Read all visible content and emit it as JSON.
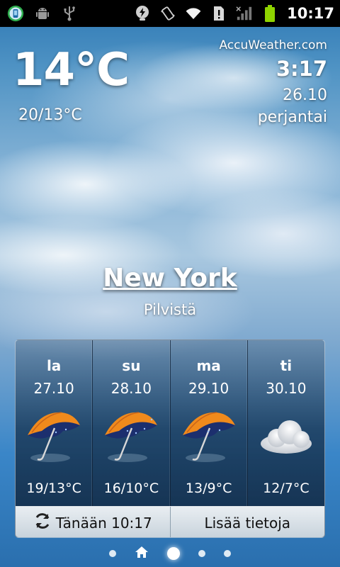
{
  "status_bar": {
    "clock": "10:17",
    "left_icons": [
      "app-notification-icon",
      "android-debug-icon",
      "usb-icon"
    ],
    "right_icons": [
      "lightbulb-icon",
      "vibrate-icon",
      "wifi-icon",
      "sim-alert-icon",
      "signal-icon",
      "battery-icon"
    ],
    "battery_color": "#8fd400"
  },
  "current": {
    "temperature": "14°C",
    "high_low": "20/13°C",
    "provider": "AccuWeather.com",
    "time": "3:17",
    "date": "26.10",
    "weekday": "perjantai",
    "city": "New York",
    "condition": "Pilvistä"
  },
  "forecast": [
    {
      "day": "la",
      "date": "27.10",
      "temp": "19/13°C",
      "icon": "umbrella-rain-icon"
    },
    {
      "day": "su",
      "date": "28.10",
      "temp": "16/10°C",
      "icon": "umbrella-rain-icon"
    },
    {
      "day": "ma",
      "date": "29.10",
      "temp": "13/9°C",
      "icon": "umbrella-rain-icon"
    },
    {
      "day": "ti",
      "date": "30.10",
      "temp": "12/7°C",
      "icon": "cloud-icon"
    }
  ],
  "buttons": {
    "refresh_label": "Tänään 10:17",
    "more_label": "Lisää tietoja"
  },
  "pager": {
    "pages": 5,
    "active_page": 3,
    "home_page": 2
  },
  "colors": {
    "umbrella_canopy": "#f08a1c",
    "umbrella_under": "#1c2f6e",
    "panel": "#1a3a5c"
  }
}
